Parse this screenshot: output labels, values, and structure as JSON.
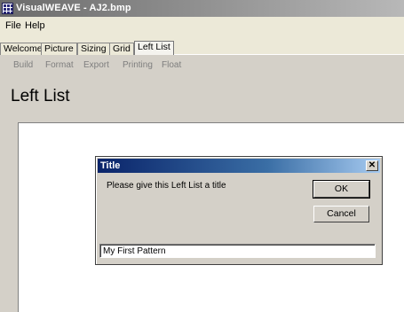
{
  "app": {
    "title": "VisualWEAVE - AJ2.bmp"
  },
  "menu": [
    "File",
    "Help"
  ],
  "tabs": [
    "Welcome",
    "Picture",
    "Sizing",
    "Grid",
    "Left List"
  ],
  "subtabs": [
    "Build",
    "Format",
    "Export",
    "Printing",
    "Float"
  ],
  "page": {
    "heading": "Left List"
  },
  "dialog": {
    "title": "Title",
    "close_glyph": "✕",
    "prompt": "Please give this Left List a title",
    "ok_label": "OK",
    "cancel_label": "Cancel",
    "input_value": "My First Pattern"
  },
  "colors": {
    "dialog_title_start": "#0a246a",
    "dialog_title_end": "#a6caf0",
    "subtab_disabled": "#7e7e7e"
  }
}
